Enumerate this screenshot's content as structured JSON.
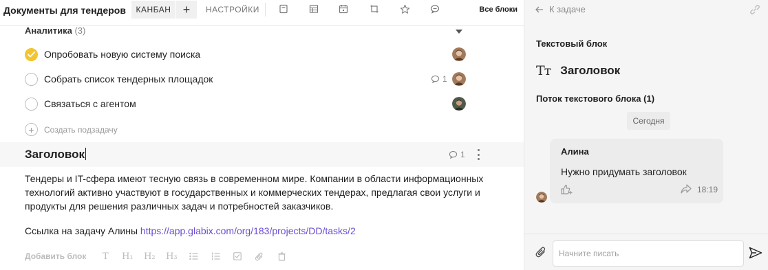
{
  "header": {
    "title": "Документы для тендеров",
    "tabs": {
      "kanban": "КАНБАН",
      "add": "+",
      "settings": "НАСТРОЙКИ"
    },
    "view_icons": [
      "document-icon",
      "table-icon",
      "calendar-icon",
      "crop-icon",
      "star-icon",
      "chat-icon"
    ],
    "all_blocks": "Все блоки"
  },
  "group": {
    "name": "Аналитика",
    "count": "(3)",
    "tasks": [
      {
        "text": "Опробовать новую систему поиска",
        "done": true,
        "comments": ""
      },
      {
        "text": "Собрать список тендерных площадок",
        "done": false,
        "comments": "1"
      },
      {
        "text": "Связаться с агентом",
        "done": false,
        "comments": ""
      }
    ],
    "add_subtask": "Создать подзадачу"
  },
  "heading_block": {
    "text": "Заголовок",
    "comments": "1"
  },
  "paragraph": "Тендеры и IT-сфера имеют тесную связь в современном мире. Компании в области информационных технологий активно участвуют в государственных и коммерческих тендерах, предлагая свои услуги и продукты для решения различных задач и потребностей заказчиков.",
  "link_line": {
    "prefix": "Ссылка на задачу Алины ",
    "url": "https://app.glabix.com/org/183/projects/DD/tasks/2"
  },
  "add_block": {
    "label": "Добавить блок",
    "tools": [
      "T",
      "H₁",
      "H₂",
      "H₃"
    ]
  },
  "side_panel": {
    "back": "К задаче",
    "section_title": "Текстовый блок",
    "block_icon": "Tт",
    "block_heading": "Заголовок",
    "thread_title": "Поток текстового блока (1)",
    "date_chip": "Сегодня",
    "message": {
      "author": "Алина",
      "text": "Нужно придумать заголовок",
      "time": "18:19"
    },
    "composer_placeholder": "Начните писать"
  },
  "colors": {
    "accent_link": "#6a4bd1",
    "checkbox_done": "#f2c530",
    "panel_bg": "#f5f5f5"
  }
}
